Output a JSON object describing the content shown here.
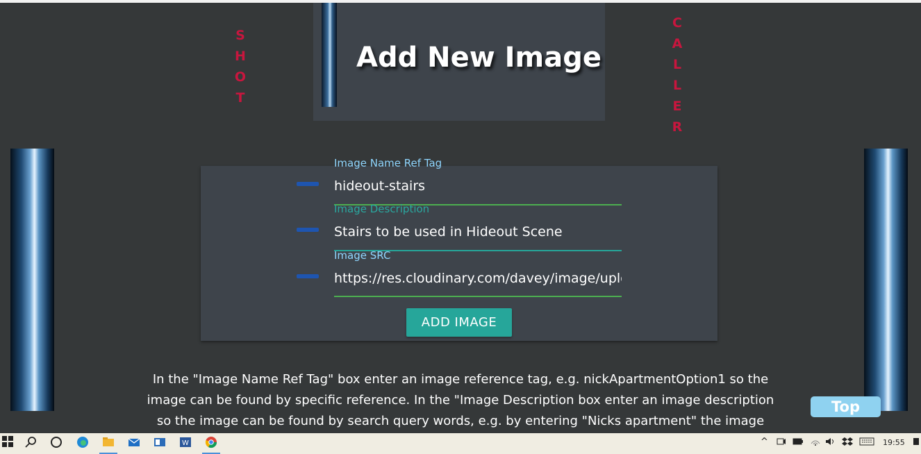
{
  "header": {
    "title": "Add New Image",
    "left_vertical": [
      "S",
      "H",
      "O",
      "T"
    ],
    "right_vertical": [
      "C",
      "A",
      "L",
      "L",
      "E",
      "R"
    ]
  },
  "form": {
    "name_label": "Image Name Ref Tag",
    "name_value": "hideout-stairs",
    "description_label": "Image Description",
    "description_value": "Stairs to be used in Hideout Scene",
    "src_label": "Image SRC",
    "src_value": "https://res.cloudinary.com/davey/image/upload",
    "submit_label": "ADD IMAGE"
  },
  "instructions": "In the \"Image Name Ref Tag\" box enter an image reference tag, e.g. nickApartmentOption1 so the image can be found by specific reference. In the \"Image Description box enter an image description so the image can be found by search query words, e.g. by entering \"Nicks apartment\" the image will",
  "top_button": "Top",
  "taskbar": {
    "time": "19:55",
    "icons": [
      "windows-start-icon",
      "search-icon",
      "task-view-icon",
      "edge-icon",
      "file-explorer-icon",
      "mail-icon",
      "outlook-icon",
      "word-icon",
      "chrome-icon"
    ],
    "tray_icons": [
      "chevron-up-icon",
      "meet-icon",
      "battery-icon",
      "wifi-icon",
      "volume-icon",
      "dropbox-icon",
      "keyboard-icon",
      "notification-icon"
    ]
  },
  "colors": {
    "background": "#353839",
    "card": "#3e444b",
    "accent": "#26a69a",
    "vertical_text": "#c8163e",
    "top_button": "#8fd2f0"
  }
}
